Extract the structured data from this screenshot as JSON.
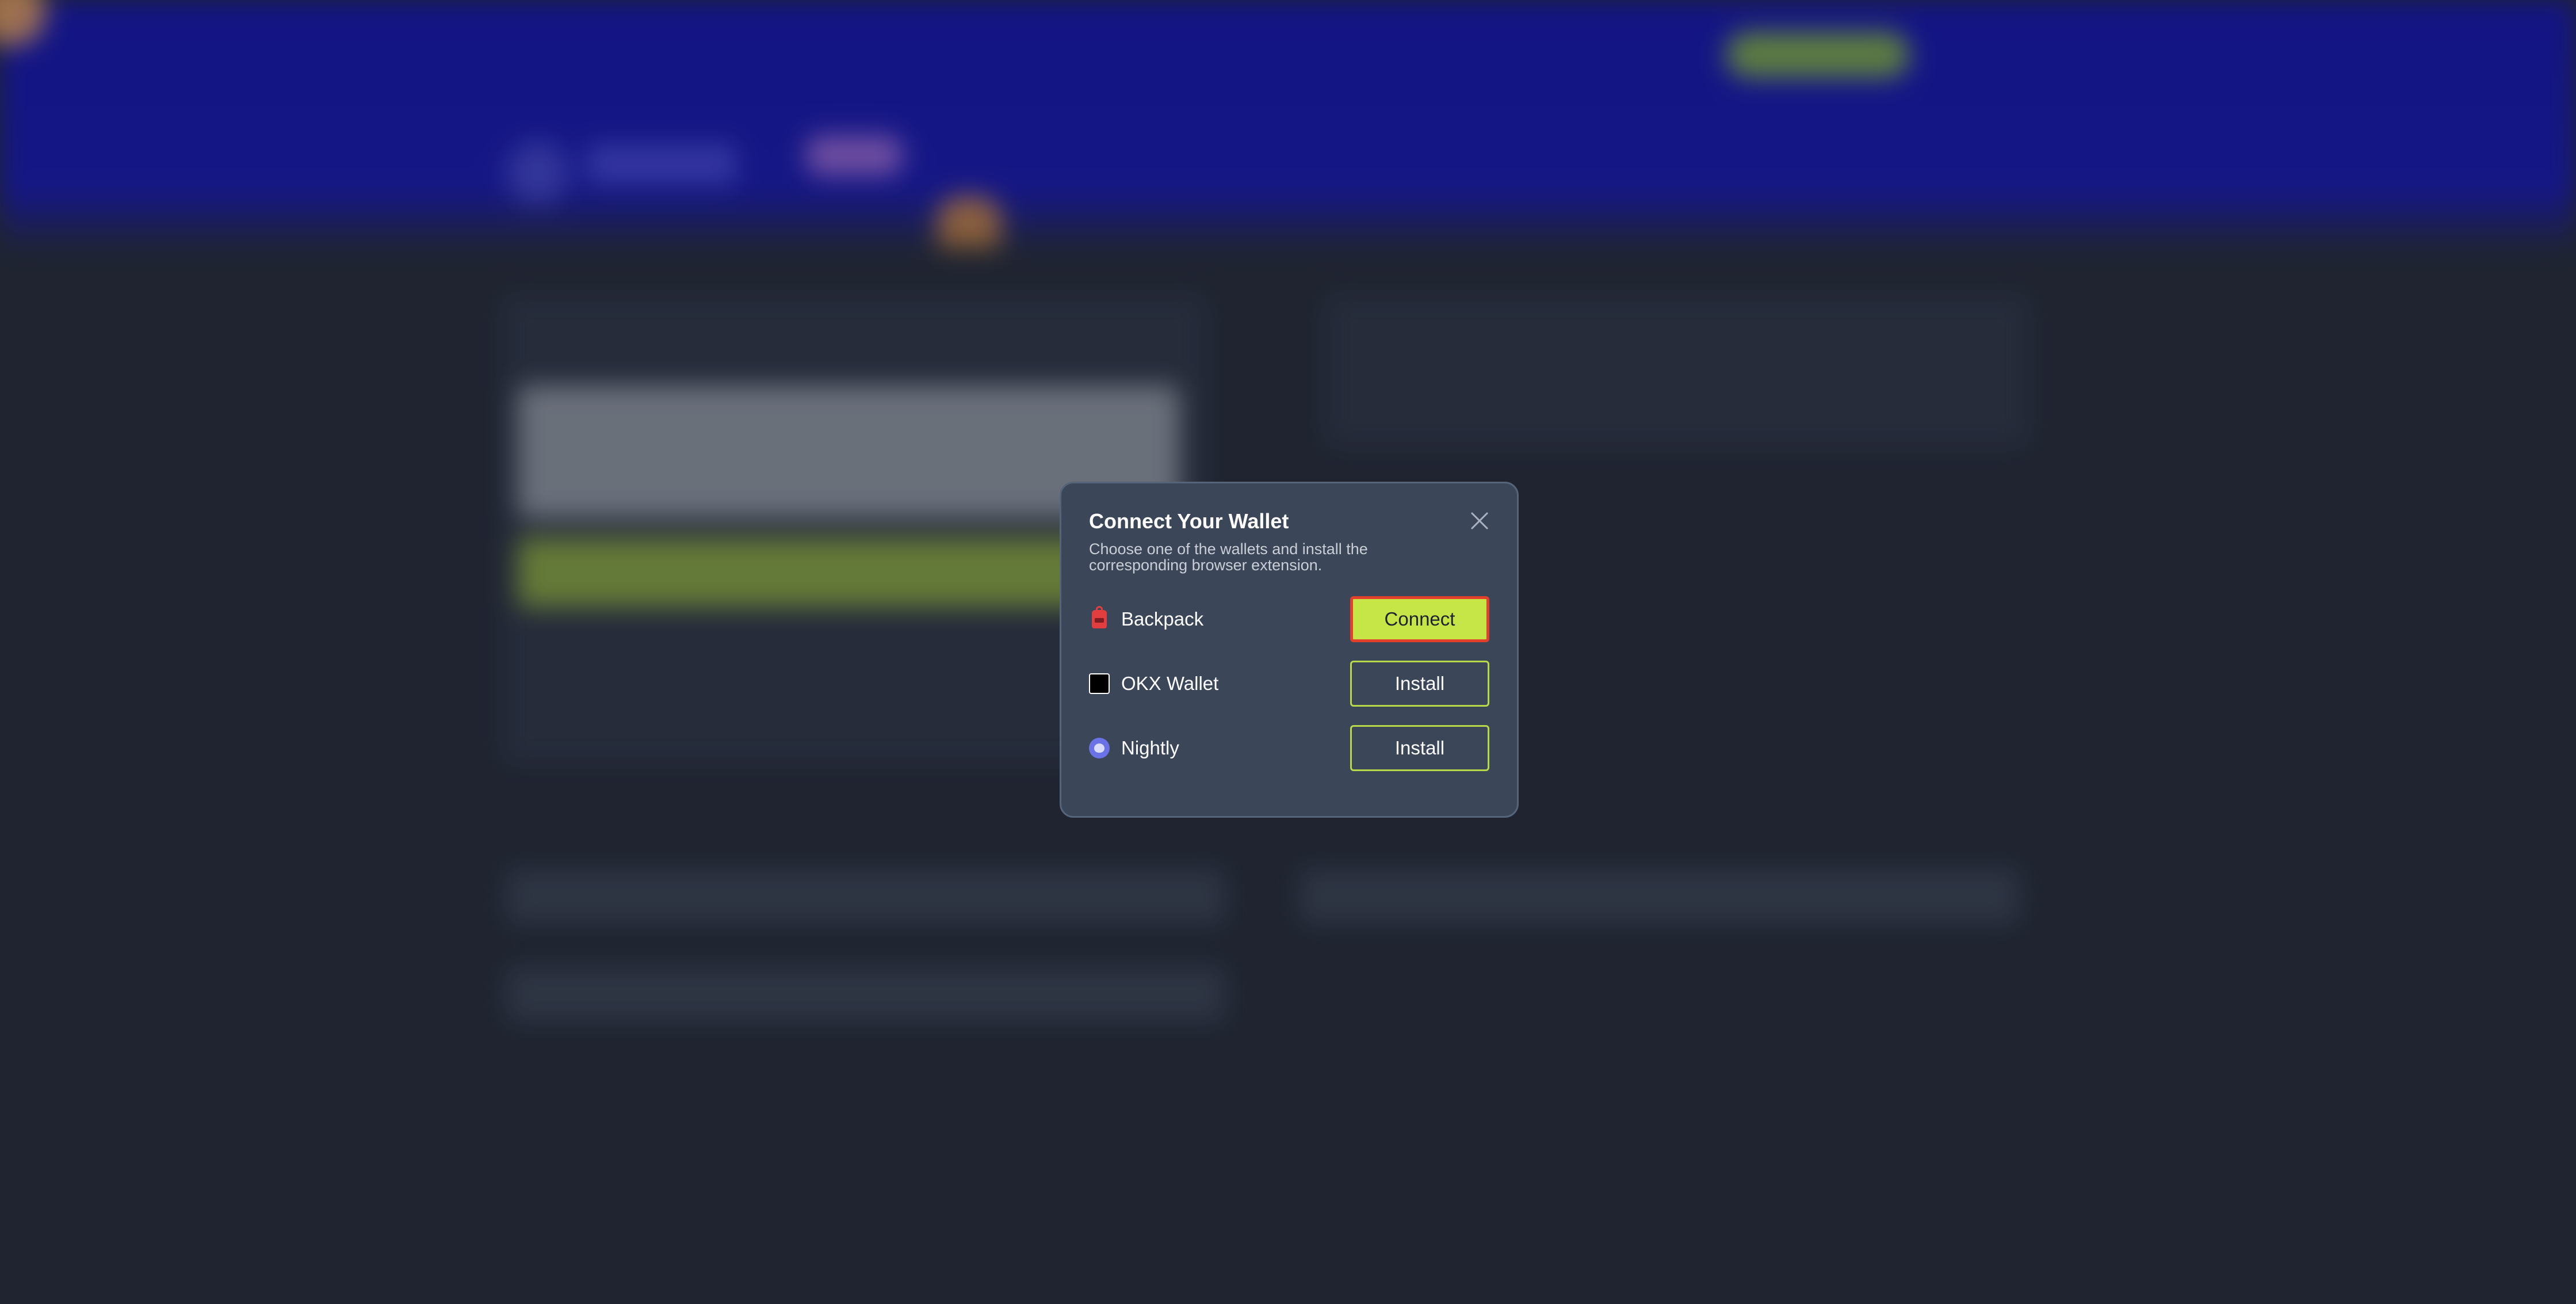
{
  "modal": {
    "title": "Connect Your Wallet",
    "subtitle": "Choose one of the wallets and install the corresponding browser extension.",
    "close_icon": "close-icon",
    "wallets": [
      {
        "name": "Backpack",
        "icon": "backpack-icon",
        "action": "Connect"
      },
      {
        "name": "OKX Wallet",
        "icon": "okx-icon",
        "action": "Install"
      },
      {
        "name": "Nightly",
        "icon": "nightly-icon",
        "action": "Install"
      }
    ]
  },
  "colors": {
    "header_bg": "#1618a0",
    "page_bg": "#232936",
    "modal_bg": "#3b4658",
    "accent": "#c6e546",
    "focus_ring": "#e2402b"
  }
}
